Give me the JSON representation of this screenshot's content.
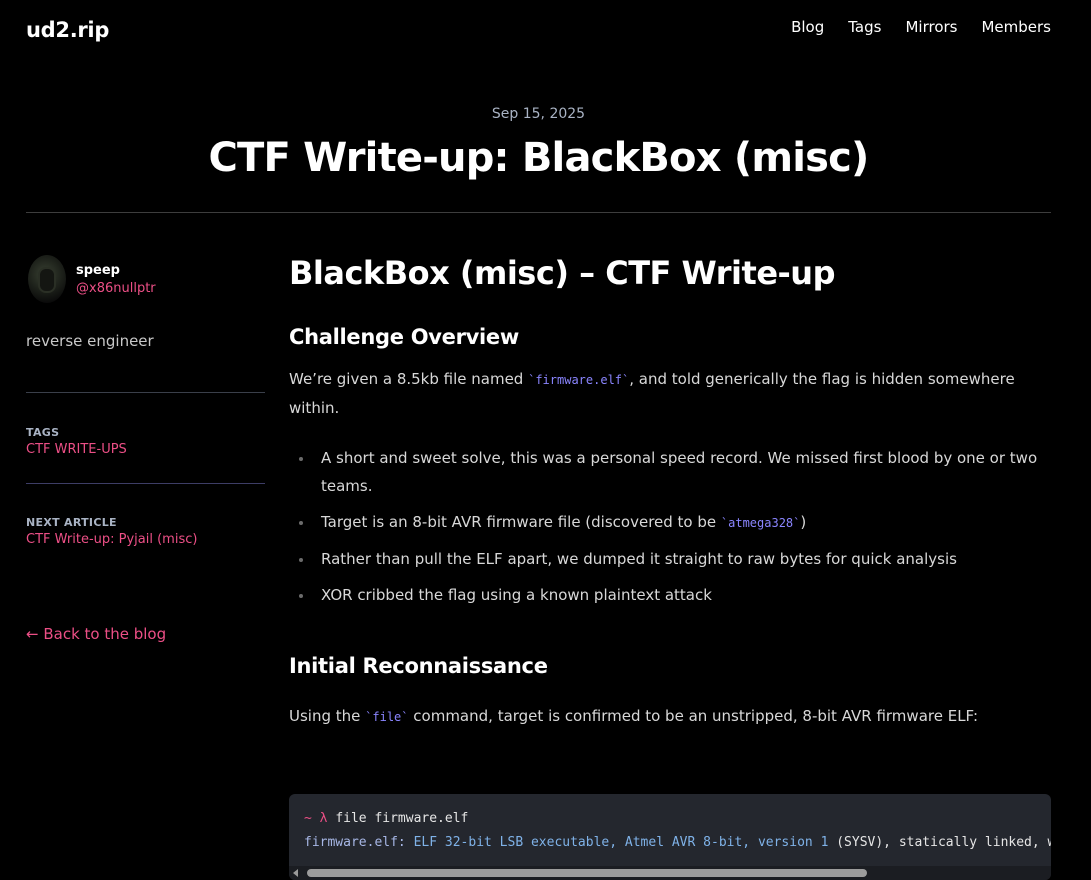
{
  "header": {
    "brand": "ud2.rip",
    "nav": [
      "Blog",
      "Tags",
      "Mirrors",
      "Members"
    ]
  },
  "post": {
    "date": "Sep 15, 2025",
    "title": "CTF Write-up: BlackBox (misc)"
  },
  "sidebar": {
    "author_name": "speep",
    "author_handle": "@x86nullptr",
    "bio": "reverse engineer",
    "tags_label": "TAGS",
    "tag": "CTF WRITE-UPS",
    "next_label": "NEXT ARTICLE",
    "next_link": "CTF Write-up: Pyjail (misc)",
    "back_link": "← Back to the blog"
  },
  "content": {
    "h1": "BlackBox (misc) – CTF Write-up",
    "overview_heading": "Challenge Overview",
    "intro_before": "We’re given a 8.5kb file named ",
    "intro_code": "`firmware.elf`",
    "intro_after": ", and told generically the flag is hidden somewhere within.",
    "bullet1": "A short and sweet solve, this was a personal speed record. We missed first blood by one or two teams.",
    "bullet2_before": "Target is an 8-bit AVR firmware file (discovered to be ",
    "bullet2_code": "`atmega328`",
    "bullet2_after": ")",
    "bullet3": "Rather than pull the ELF apart, we dumped it straight to raw bytes for quick analysis",
    "bullet4": "XOR cribbed the flag using a known plaintext attack",
    "recon_heading": "Initial Reconnaissance",
    "using_before": "Using the ",
    "using_code": "`file`",
    "using_after": " command, target is confirmed to be an unstripped, 8-bit AVR firmware ELF:"
  },
  "code": {
    "prompt": "~ λ ",
    "command": "file firmware.elf",
    "out_file": "firmware.elf:",
    "out_desc": " ELF 32-bit LSB executable, Atmel AVR 8-bit, version 1 ",
    "out_rest": "(SYSV), statically linked, wi"
  },
  "colors": {
    "background": "#000000",
    "accent": "#ec4f86",
    "inline_code": "#8a85ff",
    "code_bg": "#24272e"
  }
}
